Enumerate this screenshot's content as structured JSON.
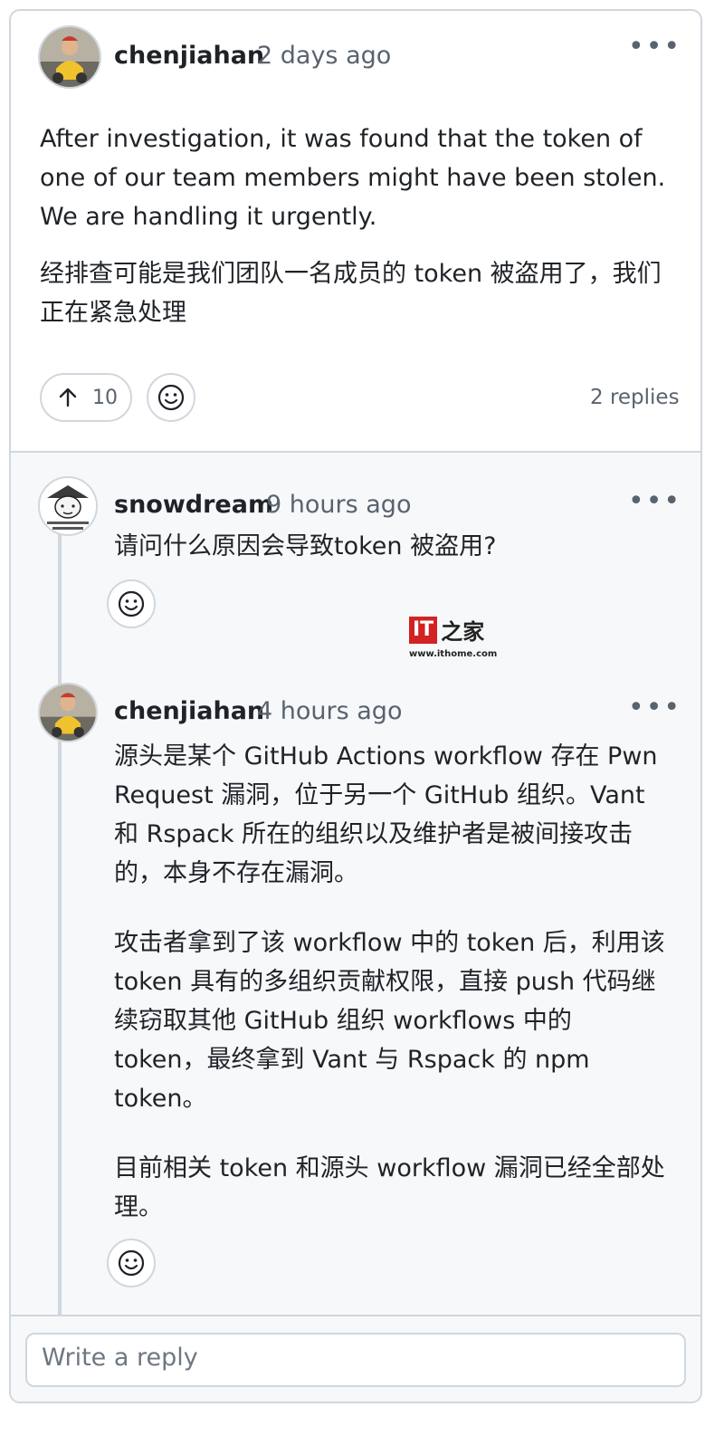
{
  "comment": {
    "author": "chenjiahan",
    "time": "2 days ago",
    "paragraph_en": "After investigation, it was found that the token of one of our team members might have been stolen. We are handling it urgently.",
    "paragraph_zh": "经排查可能是我们团队一名成员的 token 被盗用了，我们正在紧急处理",
    "upvote_count": "10",
    "replies_label": "2 replies",
    "more_icon": "kebab-horizontal-icon",
    "upvote_icon": "arrow-up-icon",
    "reaction_icon": "smiley-icon"
  },
  "replies": [
    {
      "author": "snowdream",
      "time": "9 hours ago",
      "paragraphs": [
        "请问什么原因会导致token 被盗用?"
      ]
    },
    {
      "author": "chenjiahan",
      "time": "4 hours ago",
      "paragraphs": [
        "源头是某个 GitHub Actions workflow 存在 Pwn Request 漏洞，位于另一个 GitHub 组织。Vant 和 Rspack 所在的组织以及维护者是被间接攻击的，本身不存在漏洞。",
        "攻击者拿到了该 workflow 中的 token 后，利用该 token 具有的多组织贡献权限，直接 push 代码继续窃取其他 GitHub 组织 workflows 中的 token，最终拿到 Vant 与 Rspack 的 npm token。",
        "目前相关 token 和源头 workflow 漏洞已经全部处理。"
      ]
    }
  ],
  "reply_box": {
    "placeholder": "Write a reply"
  },
  "watermark": {
    "logo": "IT之家",
    "url": "www.ithome.com"
  },
  "colors": {
    "border": "#d0d7de",
    "muted": "#59636e",
    "thread_bg": "#f6f8fa",
    "watermark_red": "#d22222"
  }
}
